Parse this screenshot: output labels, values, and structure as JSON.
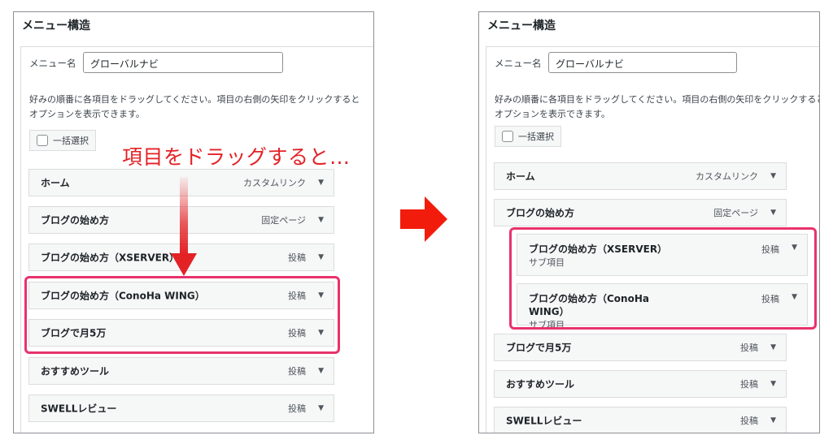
{
  "colors": {
    "accent_red": "#e32226",
    "highlight_pink": "#e9326c",
    "item_bg": "#f6f7f7"
  },
  "annotation": {
    "caption": "項目をドラッグすると…",
    "drag_arrow_icon": "red-down-arrow-icon",
    "transition_arrow_icon": "red-right-arrow-icon"
  },
  "left": {
    "title": "メニュー構造",
    "menu_name_label": "メニュー名",
    "menu_name_value": "グローバルナビ",
    "instructions_line1": "好みの順番に各項目をドラッグしてください。項目の右側の矢印をクリックすると",
    "instructions_line2": "オプションを表示できます。",
    "bulk_select": "一括選択",
    "items": [
      {
        "title": "ホーム",
        "type": "カスタムリンク"
      },
      {
        "title": "ブログの始め方",
        "type": "固定ページ"
      },
      {
        "title": "ブログの始め方（XSERVER）",
        "type": "投稿"
      },
      {
        "title": "ブログの始め方（ConoHa WING）",
        "type": "投稿"
      },
      {
        "title": "ブログで月5万",
        "type": "投稿"
      },
      {
        "title": "おすすめツール",
        "type": "投稿"
      },
      {
        "title": "SWELLレビュー",
        "type": "投稿"
      }
    ]
  },
  "right": {
    "title": "メニュー構造",
    "menu_name_label": "メニュー名",
    "menu_name_value": "グローバルナビ",
    "instructions_line1": "好みの順番に各項目をドラッグしてください。項目の右側の矢印をクリックすると",
    "instructions_line2": "オプションを表示できます。",
    "bulk_select": "一括選択",
    "items": [
      {
        "title": "ホーム",
        "type": "カスタムリンク"
      },
      {
        "title": "ブログの始め方",
        "type": "固定ページ"
      },
      {
        "title": "ブログの始め方（XSERVER）",
        "sub": "サブ項目",
        "type": "投稿"
      },
      {
        "title": "ブログの始め方（ConoHa WING）",
        "sub": "サブ項目",
        "type": "投稿"
      },
      {
        "title": "ブログで月5万",
        "type": "投稿"
      },
      {
        "title": "おすすめツール",
        "type": "投稿"
      },
      {
        "title": "SWELLレビュー",
        "type": "投稿"
      }
    ]
  }
}
